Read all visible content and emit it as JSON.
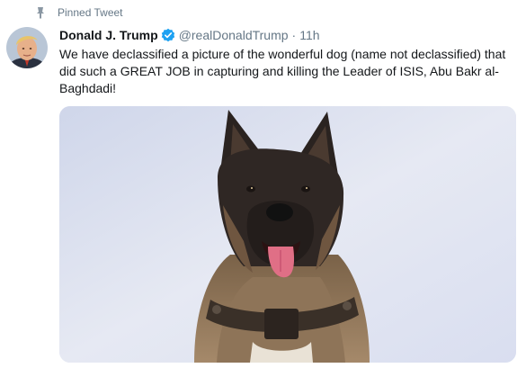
{
  "pinned": {
    "label": "Pinned Tweet",
    "icon": "pin-icon"
  },
  "tweet": {
    "display_name": "Donald J. Trump",
    "verified_icon": "verified-badge-icon",
    "handle": "@realDonaldTrump",
    "separator": "·",
    "timestamp": "11h",
    "text": "We have declassified a picture of the wonderful dog (name not declassified) that did such a GREAT JOB in capturing and killing the Leader of ISIS, Abu Bakr al-Baghdadi!",
    "accent_color": "#1da1f2"
  },
  "avatar": {
    "icon": "profile-avatar"
  },
  "media": {
    "icon": "dog-photo"
  }
}
